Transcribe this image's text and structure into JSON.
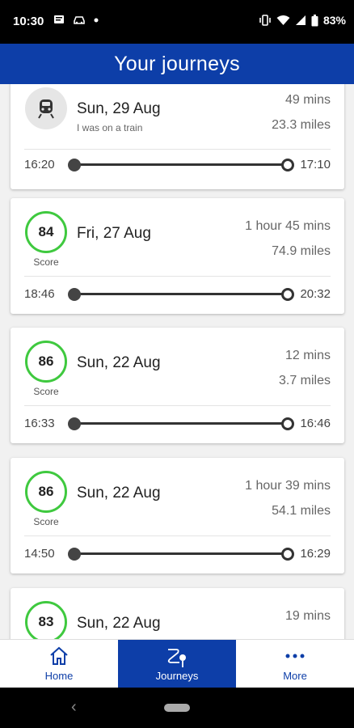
{
  "status_bar": {
    "time": "10:30",
    "battery": "83%",
    "icons": [
      "message-icon",
      "car-icon",
      "dot-icon",
      "vibrate-icon",
      "wifi-icon",
      "signal-icon",
      "battery-icon"
    ]
  },
  "header": {
    "title": "Your journeys"
  },
  "colors": {
    "brand_blue": "#0d3ea8",
    "score_ring": "#3fc93f",
    "background": "#f1f1f1"
  },
  "journeys": [
    {
      "type": "train",
      "icon": "train-icon",
      "date": "Sun, 29 Aug",
      "note": "I was on a train",
      "duration": "49 mins",
      "distance": "23.3 miles",
      "start": "16:20",
      "end": "17:10"
    },
    {
      "type": "score",
      "score": "84",
      "score_label": "Score",
      "date": "Fri, 27 Aug",
      "duration": "1 hour 45 mins",
      "distance": "74.9 miles",
      "start": "18:46",
      "end": "20:32"
    },
    {
      "type": "score",
      "score": "86",
      "score_label": "Score",
      "date": "Sun, 22 Aug",
      "duration": "12 mins",
      "distance": "3.7 miles",
      "start": "16:33",
      "end": "16:46"
    },
    {
      "type": "score",
      "score": "86",
      "score_label": "Score",
      "date": "Sun, 22 Aug",
      "duration": "1 hour 39 mins",
      "distance": "54.1 miles",
      "start": "14:50",
      "end": "16:29"
    },
    {
      "type": "score",
      "score": "83",
      "date": "Sun, 22 Aug",
      "duration": "19 mins"
    }
  ],
  "bottom_nav": {
    "items": [
      {
        "label": "Home",
        "icon": "home-icon",
        "active": false
      },
      {
        "label": "Journeys",
        "icon": "route-icon",
        "active": true
      },
      {
        "label": "More",
        "icon": "more-dots-icon",
        "active": false
      }
    ]
  }
}
